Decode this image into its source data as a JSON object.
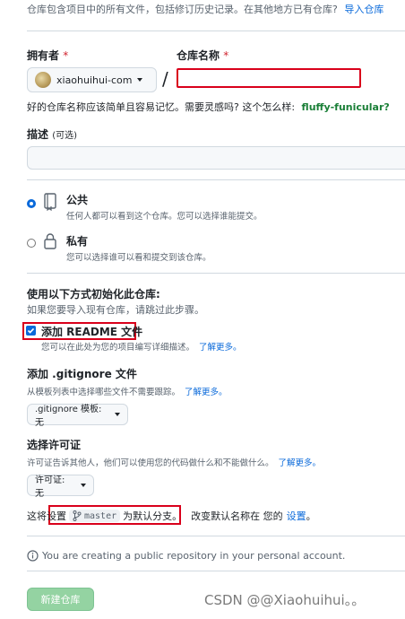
{
  "intro": {
    "text": "仓库包含项目中的所有文件，包括修订历史记录。在其他地方已有仓库?",
    "import_link": "导入仓库"
  },
  "owner": {
    "label": "拥有者",
    "required": "*",
    "selected": "xiaohuihui-com"
  },
  "separator": "/",
  "repo_name": {
    "label": "仓库名称",
    "required": "*",
    "value": ""
  },
  "name_hint": {
    "text": "好的仓库名称应该简单且容易记忆。需要灵感吗? 这个怎么样:",
    "suggestion": "fluffy-funicular?"
  },
  "description": {
    "label": "描述",
    "optional": "(可选)",
    "value": ""
  },
  "visibility": {
    "public": {
      "title": "公共",
      "desc": "任何人都可以看到这个仓库。您可以选择谁能提交。",
      "selected": true
    },
    "private": {
      "title": "私有",
      "desc": "您可以选择谁可以看和提交到该仓库。",
      "selected": false
    }
  },
  "init": {
    "heading": "使用以下方式初始化此仓库:",
    "subtext": "如果您要导入现有仓库，请跳过此步骤。",
    "readme": {
      "label": "添加 README 文件",
      "checked": true,
      "desc": "您可以在此处为您的项目编写详细描述。",
      "learn_more": "了解更多。"
    },
    "gitignore": {
      "label": "添加 .gitignore 文件",
      "desc": "从模板列表中选择哪些文件不需要跟踪。",
      "learn_more": "了解更多。",
      "button": ".gitignore 模板: 无"
    },
    "license": {
      "label": "选择许可证",
      "desc": "许可证告诉其他人，他们可以使用您的代码做什么和不能做什么。",
      "learn_more": "了解更多。",
      "button": "许可证: 无"
    }
  },
  "branch": {
    "prefix": "这将设置",
    "name": "master",
    "suffix": "为默认分支。",
    "change_text": "改变默认名称在 您的",
    "settings_link": "设置",
    "end": "。"
  },
  "notice": "You are creating a public repository in your personal account.",
  "submit": "新建仓库",
  "watermark": "CSDN @@Xiaohuihui。。",
  "colors": {
    "accent": "#0969da",
    "highlight_box": "#d9001b",
    "submit_bg": "#94d3a2",
    "suggestion": "#1a7f37"
  }
}
